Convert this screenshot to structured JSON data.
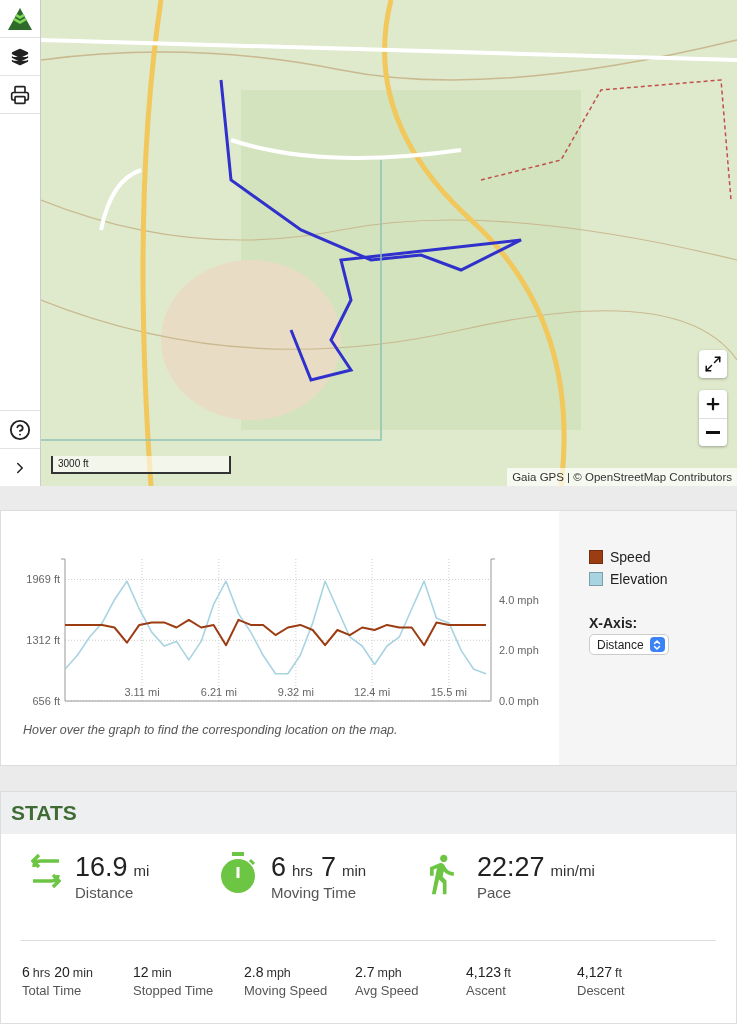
{
  "map": {
    "kind": "picture",
    "scale": "3000 ft",
    "attribution": "Gaia GPS | © OpenStreetMap Contributors"
  },
  "elevation_chart": {
    "chart_data": {
      "type": "line",
      "x": [
        0,
        0.5,
        1,
        1.5,
        2,
        2.5,
        3,
        3.5,
        4,
        4.5,
        5,
        5.5,
        6,
        6.5,
        7,
        7.5,
        8,
        8.5,
        9,
        9.5,
        10,
        10.5,
        11,
        11.5,
        12,
        12.5,
        13,
        13.5,
        14,
        14.5,
        15,
        15.5,
        16,
        16.5,
        17
      ],
      "grid": true,
      "xlim": [
        0,
        17.2
      ],
      "ylim": [
        656,
        2190
      ],
      "xticks": [
        {
          "value": 3.11,
          "label": "3.11 mi"
        },
        {
          "value": 6.21,
          "label": "6.21 mi"
        },
        {
          "value": 9.32,
          "label": "9.32 mi"
        },
        {
          "value": 12.4,
          "label": "12.4 mi"
        },
        {
          "value": 15.5,
          "label": "15.5 mi"
        }
      ],
      "yticks": [
        {
          "value": 656,
          "label": "656 ft"
        },
        {
          "value": 1312,
          "label": "1312 ft"
        },
        {
          "value": 1969,
          "label": "1969 ft"
        }
      ],
      "y2lim": [
        0,
        5.6
      ],
      "y2ticks": [
        {
          "value": 0,
          "label": "0.0 mph"
        },
        {
          "value": 2,
          "label": "2.0 mph"
        },
        {
          "value": 4,
          "label": "4.0 mph"
        }
      ],
      "series": [
        {
          "name": "Speed",
          "color": "#9b3c12",
          "axis": "y2",
          "values": [
            3.0,
            3.0,
            3.0,
            3.0,
            2.9,
            2.3,
            3.0,
            3.1,
            3.1,
            2.9,
            3.2,
            2.9,
            3.0,
            2.2,
            3.2,
            3.0,
            3.0,
            2.6,
            2.9,
            3.0,
            2.8,
            2.2,
            2.8,
            2.6,
            2.9,
            2.8,
            3.0,
            2.9,
            2.9,
            2.2,
            3.1,
            3.0,
            3.0,
            3.0,
            3.0
          ]
        },
        {
          "name": "Elevation",
          "color": "#a8d4e2",
          "values": [
            1000,
            1150,
            1350,
            1500,
            1750,
            1950,
            1650,
            1400,
            1250,
            1300,
            1100,
            1300,
            1700,
            1950,
            1600,
            1400,
            1150,
            950,
            950,
            1150,
            1500,
            1950,
            1650,
            1350,
            1250,
            1050,
            1250,
            1350,
            1650,
            1950,
            1550,
            1500,
            1200,
            1000,
            950
          ]
        }
      ]
    },
    "caption": "Hover over the graph to find the corresponding location on the map.",
    "x_axis": {
      "label": "X-Axis:",
      "value": "Distance"
    }
  },
  "stats": {
    "title": "STATS",
    "main": [
      {
        "kind": "distance",
        "parts": [
          {
            "value": "16.9",
            "unit": "mi"
          }
        ],
        "label": "Distance"
      },
      {
        "kind": "time",
        "parts": [
          {
            "value": "6",
            "unit": "hrs"
          },
          {
            "value": "7",
            "unit": "min"
          }
        ],
        "label": "Moving Time"
      },
      {
        "kind": "pace",
        "parts": [
          {
            "value": "22:27",
            "unit": "min/mi"
          }
        ],
        "label": "Pace"
      }
    ],
    "details": [
      {
        "parts": [
          {
            "value": "6",
            "unit": "hrs"
          },
          {
            "value": "20",
            "unit": "min"
          }
        ],
        "label": "Total Time"
      },
      {
        "parts": [
          {
            "value": "12",
            "unit": "min"
          }
        ],
        "label": "Stopped Time"
      },
      {
        "parts": [
          {
            "value": "2.8",
            "unit": "mph"
          }
        ],
        "label": "Moving Speed"
      },
      {
        "parts": [
          {
            "value": "2.7",
            "unit": "mph"
          }
        ],
        "label": "Avg Speed"
      },
      {
        "parts": [
          {
            "value": "4,123",
            "unit": "ft"
          }
        ],
        "label": "Ascent"
      },
      {
        "parts": [
          {
            "value": "4,127",
            "unit": "ft"
          }
        ],
        "label": "Descent"
      }
    ]
  }
}
